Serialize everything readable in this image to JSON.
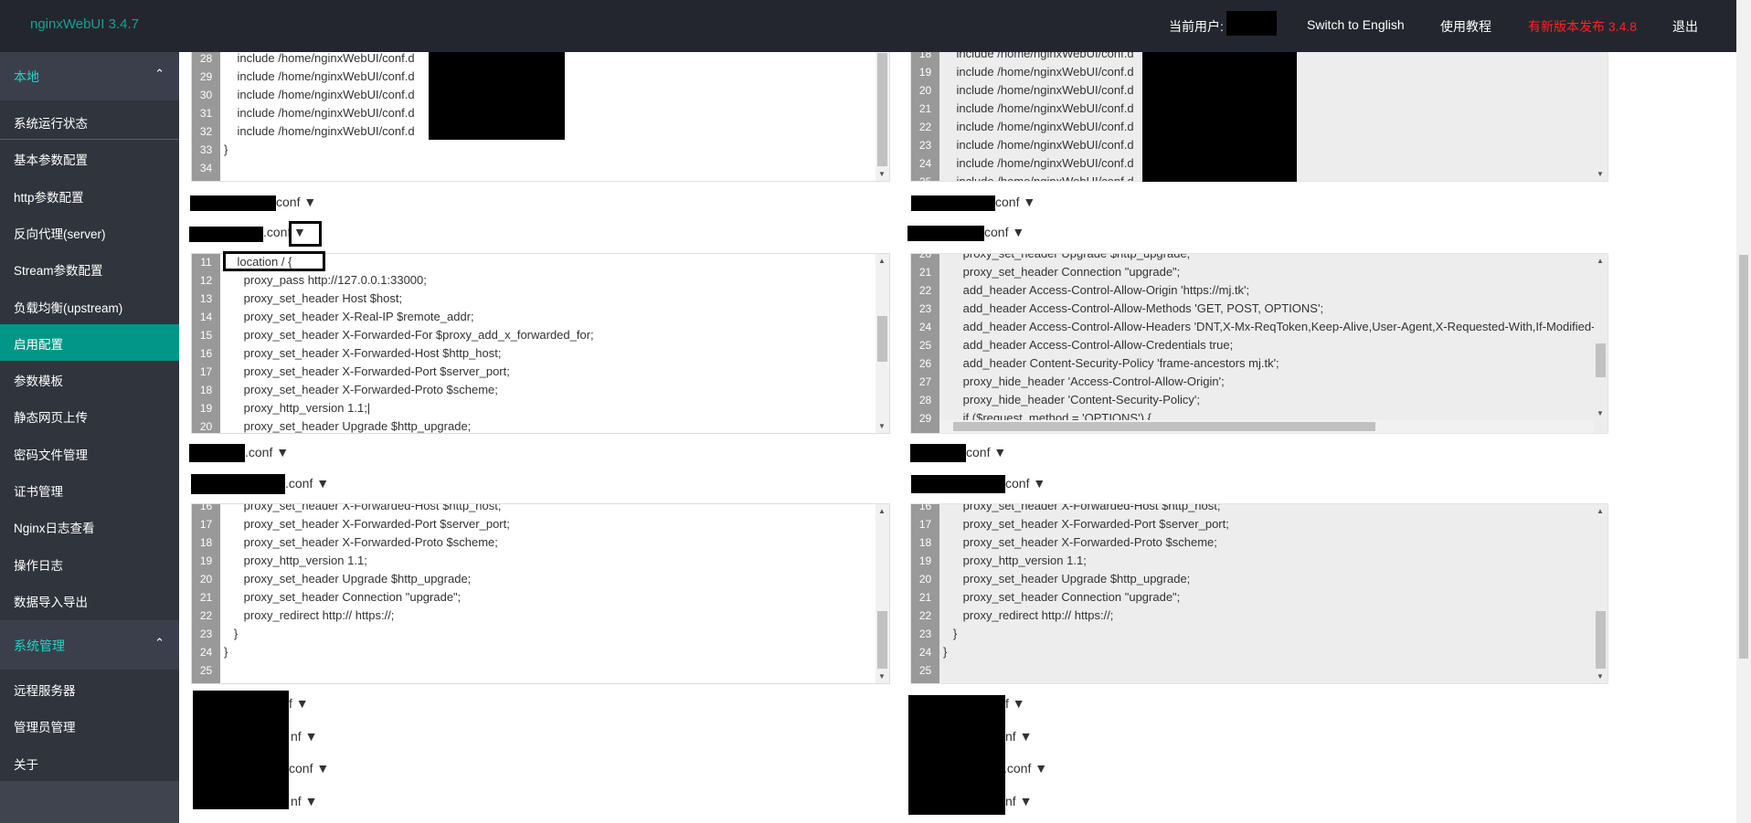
{
  "header": {
    "logo": "nginxWebUI 3.4.7",
    "current_user_label": "当前用户:",
    "switch_language": "Switch to English",
    "tutorial": "使用教程",
    "new_version": "有新版本发布 3.4.8",
    "logout": "退出"
  },
  "colors": {
    "accent": "#009688",
    "header_bg": "#23262e",
    "sidebar_bg": "#30343d",
    "new_version": "#ff2222"
  },
  "sidebar": {
    "group_local": "本地",
    "group_system": "系统管理",
    "items": [
      "系统运行状态",
      "基本参数配置",
      "http参数配置",
      "反向代理(server)",
      "Stream参数配置",
      "负载均衡(upstream)",
      "启用配置",
      "参数模板",
      "静态网页上传",
      "密码文件管理",
      "证书管理",
      "Nginx日志查看",
      "操作日志",
      "数据导入导出"
    ],
    "active_item": "启用配置",
    "system_items": [
      "远程服务器",
      "管理员管理",
      "关于"
    ],
    "collapse_icon": "chevron-up-icon"
  },
  "editors": [
    {
      "lines": [
        {
          "n": "28",
          "t": "    include /home/nginxWebUI/conf.d"
        },
        {
          "n": "29",
          "t": "    include /home/nginxWebUI/conf.d"
        },
        {
          "n": "30",
          "t": "    include /home/nginxWebUI/conf.d"
        },
        {
          "n": "31",
          "t": "    include /home/nginxWebUI/conf.d"
        },
        {
          "n": "32",
          "t": "    include /home/nginxWebUI/conf.d"
        },
        {
          "n": "33",
          "t": "}"
        },
        {
          "n": "34",
          "t": ""
        }
      ]
    },
    {
      "lines": [
        {
          "n": "18",
          "t": "    include /home/nginxWebUI/conf.d"
        },
        {
          "n": "19",
          "t": "    include /home/nginxWebUI/conf.d"
        },
        {
          "n": "20",
          "t": "    include /home/nginxWebUI/conf.d"
        },
        {
          "n": "21",
          "t": "    include /home/nginxWebUI/conf.d"
        },
        {
          "n": "22",
          "t": "    include /home/nginxWebUI/conf.d"
        },
        {
          "n": "23",
          "t": "    include /home/nginxWebUI/conf.d"
        },
        {
          "n": "24",
          "t": "    include /home/nginxWebUI/conf.d"
        },
        {
          "n": "25",
          "t": "    include /home/nginxWebUI/conf.d"
        }
      ]
    },
    {
      "lines": [
        {
          "n": "11",
          "t": "    location / {"
        },
        {
          "n": "12",
          "t": "      proxy_pass http://127.0.0.1:33000;"
        },
        {
          "n": "13",
          "t": "      proxy_set_header Host $host;"
        },
        {
          "n": "14",
          "t": "      proxy_set_header X-Real-IP $remote_addr;"
        },
        {
          "n": "15",
          "t": "      proxy_set_header X-Forwarded-For $proxy_add_x_forwarded_for;"
        },
        {
          "n": "16",
          "t": "      proxy_set_header X-Forwarded-Host $http_host;"
        },
        {
          "n": "17",
          "t": "      proxy_set_header X-Forwarded-Port $server_port;"
        },
        {
          "n": "18",
          "t": "      proxy_set_header X-Forwarded-Proto $scheme;"
        },
        {
          "n": "19",
          "t": "      proxy_http_version 1.1;|"
        },
        {
          "n": "20",
          "t": "      proxy_set_header Upgrade $http_upgrade;"
        }
      ]
    },
    {
      "lines": [
        {
          "n": "20",
          "t": "      proxy_set_header Upgrade $http_upgrade;"
        },
        {
          "n": "21",
          "t": "      proxy_set_header Connection \"upgrade\";"
        },
        {
          "n": "22",
          "t": "      add_header Access-Control-Allow-Origin 'https://mj.tk';"
        },
        {
          "n": "23",
          "t": "      add_header Access-Control-Allow-Methods 'GET, POST, OPTIONS';"
        },
        {
          "n": "24",
          "t": "      add_header Access-Control-Allow-Headers 'DNT,X-Mx-ReqToken,Keep-Alive,User-Agent,X-Requested-With,If-Modified-Since'"
        },
        {
          "n": "25",
          "t": "      add_header Access-Control-Allow-Credentials true;"
        },
        {
          "n": "26",
          "t": "      add_header Content-Security-Policy 'frame-ancestors mj.tk';"
        },
        {
          "n": "27",
          "t": "      proxy_hide_header 'Access-Control-Allow-Origin';"
        },
        {
          "n": "28",
          "t": "      proxy_hide_header 'Content-Security-Policy';"
        },
        {
          "n": "29",
          "t": "      if ($request_method = 'OPTIONS') {"
        }
      ]
    },
    {
      "lines": [
        {
          "n": "16",
          "t": "      proxy_set_header X-Forwarded-Host $http_host;"
        },
        {
          "n": "17",
          "t": "      proxy_set_header X-Forwarded-Port $server_port;"
        },
        {
          "n": "18",
          "t": "      proxy_set_header X-Forwarded-Proto $scheme;"
        },
        {
          "n": "19",
          "t": "      proxy_http_version 1.1;"
        },
        {
          "n": "20",
          "t": "      proxy_set_header Upgrade $http_upgrade;"
        },
        {
          "n": "21",
          "t": "      proxy_set_header Connection \"upgrade\";"
        },
        {
          "n": "22",
          "t": "      proxy_redirect http:// https://;"
        },
        {
          "n": "23",
          "t": "   }"
        },
        {
          "n": "24",
          "t": "}"
        },
        {
          "n": "25",
          "t": ""
        }
      ]
    },
    {
      "lines": [
        {
          "n": "16",
          "t": "      proxy_set_header X-Forwarded-Host $http_host;"
        },
        {
          "n": "17",
          "t": "      proxy_set_header X-Forwarded-Port $server_port;"
        },
        {
          "n": "18",
          "t": "      proxy_set_header X-Forwarded-Proto $scheme;"
        },
        {
          "n": "19",
          "t": "      proxy_http_version 1.1;"
        },
        {
          "n": "20",
          "t": "      proxy_set_header Upgrade $http_upgrade;"
        },
        {
          "n": "21",
          "t": "      proxy_set_header Connection \"upgrade\";"
        },
        {
          "n": "22",
          "t": "      proxy_redirect http:// https://;"
        },
        {
          "n": "23",
          "t": "   }"
        },
        {
          "n": "24",
          "t": "}"
        },
        {
          "n": "25",
          "t": ""
        }
      ]
    }
  ],
  "file_labels": {
    "left": [
      "conf ▼",
      ".conf",
      ".conf ▼",
      ".conf ▼",
      "f ▼",
      "nf ▼",
      "conf ▼",
      "nf ▼"
    ],
    "right": [
      "conf ▼",
      "conf ▼",
      "conf ▼",
      "conf ▼",
      "f ▼",
      "nf ▼",
      ".conf ▼",
      "nf ▼"
    ],
    "toggle_glyph": "▼"
  }
}
